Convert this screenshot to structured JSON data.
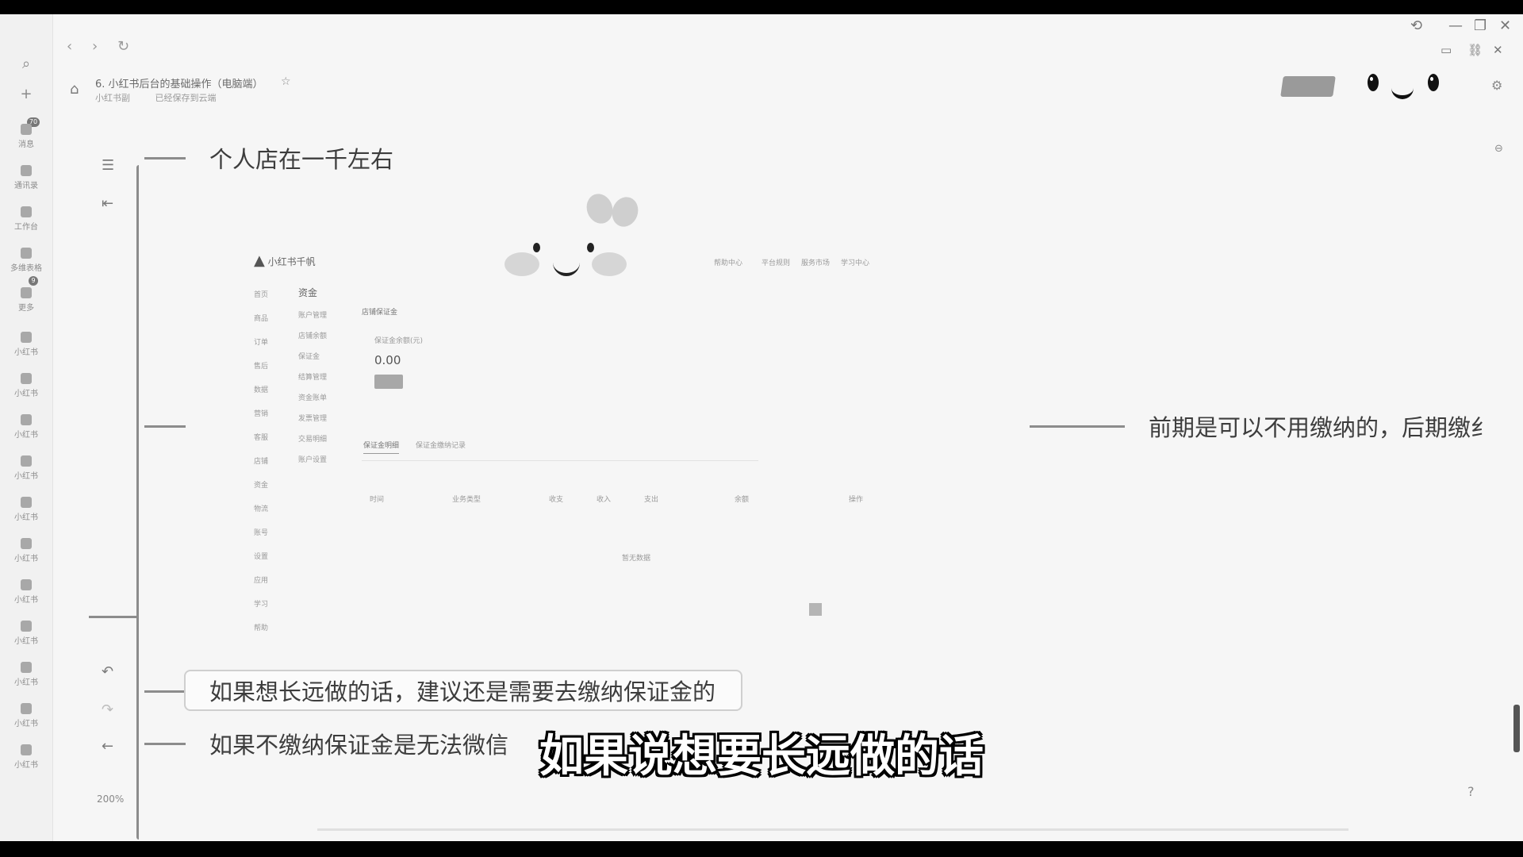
{
  "window": {
    "nav": [
      "‹",
      "›",
      "↻"
    ],
    "controls": [
      "⟲",
      "—",
      "❐",
      "✕"
    ],
    "extra_controls": [
      "▭",
      "⛓",
      "✕"
    ]
  },
  "document": {
    "title": "6. 小红书后台的基础操作（电脑端）",
    "folder": "小红书副",
    "save_status": "已经保存到云端"
  },
  "leftbar": {
    "badge_top": "70",
    "badge_mid": "9",
    "items": [
      "消息",
      "通讯录",
      "工作台",
      "多维表格",
      "更多",
      "小红书",
      "小红书",
      "小红书",
      "小红书",
      "小红书",
      "小红书",
      "小红书",
      "小红书",
      "小红书",
      "小红书",
      "小红书"
    ]
  },
  "mindmap": {
    "zoom": "200%",
    "nodes": {
      "n1": "个人店在一千左右",
      "n2": "前期是可以不用缴纳的，后期缴纟",
      "n3": "如果想长远做的话，建议还是需要去缴纳保证金的",
      "n4": "如果不缴纳保证金是无法微信"
    }
  },
  "embedded": {
    "logo": "小红书千帆",
    "nav_items": [
      "帮助中心",
      "平台规则",
      "服务市场",
      "学习中心"
    ],
    "page_title": "资金",
    "section": "店铺保证金",
    "balance_label": "保证金余额(元)",
    "balance": "0.00",
    "side": [
      "首页",
      "商品",
      "订单",
      "售后",
      "数据",
      "营销",
      "客服",
      "店铺",
      "资金",
      "物流",
      "账号",
      "设置",
      "应用",
      "学习",
      "帮助"
    ],
    "sub_menu": [
      "账户管理",
      "店铺余额",
      "保证金",
      "结算管理",
      "资金账单",
      "发票管理",
      "交易明细",
      "账户设置"
    ],
    "tabs": [
      "保证金明细",
      "保证金缴纳记录"
    ],
    "columns": [
      "时间",
      "业务类型",
      "收支",
      "收入",
      "支出",
      "余额",
      "操作"
    ],
    "empty": "暂无数据"
  },
  "subtitle": "如果说想要长远做的话"
}
